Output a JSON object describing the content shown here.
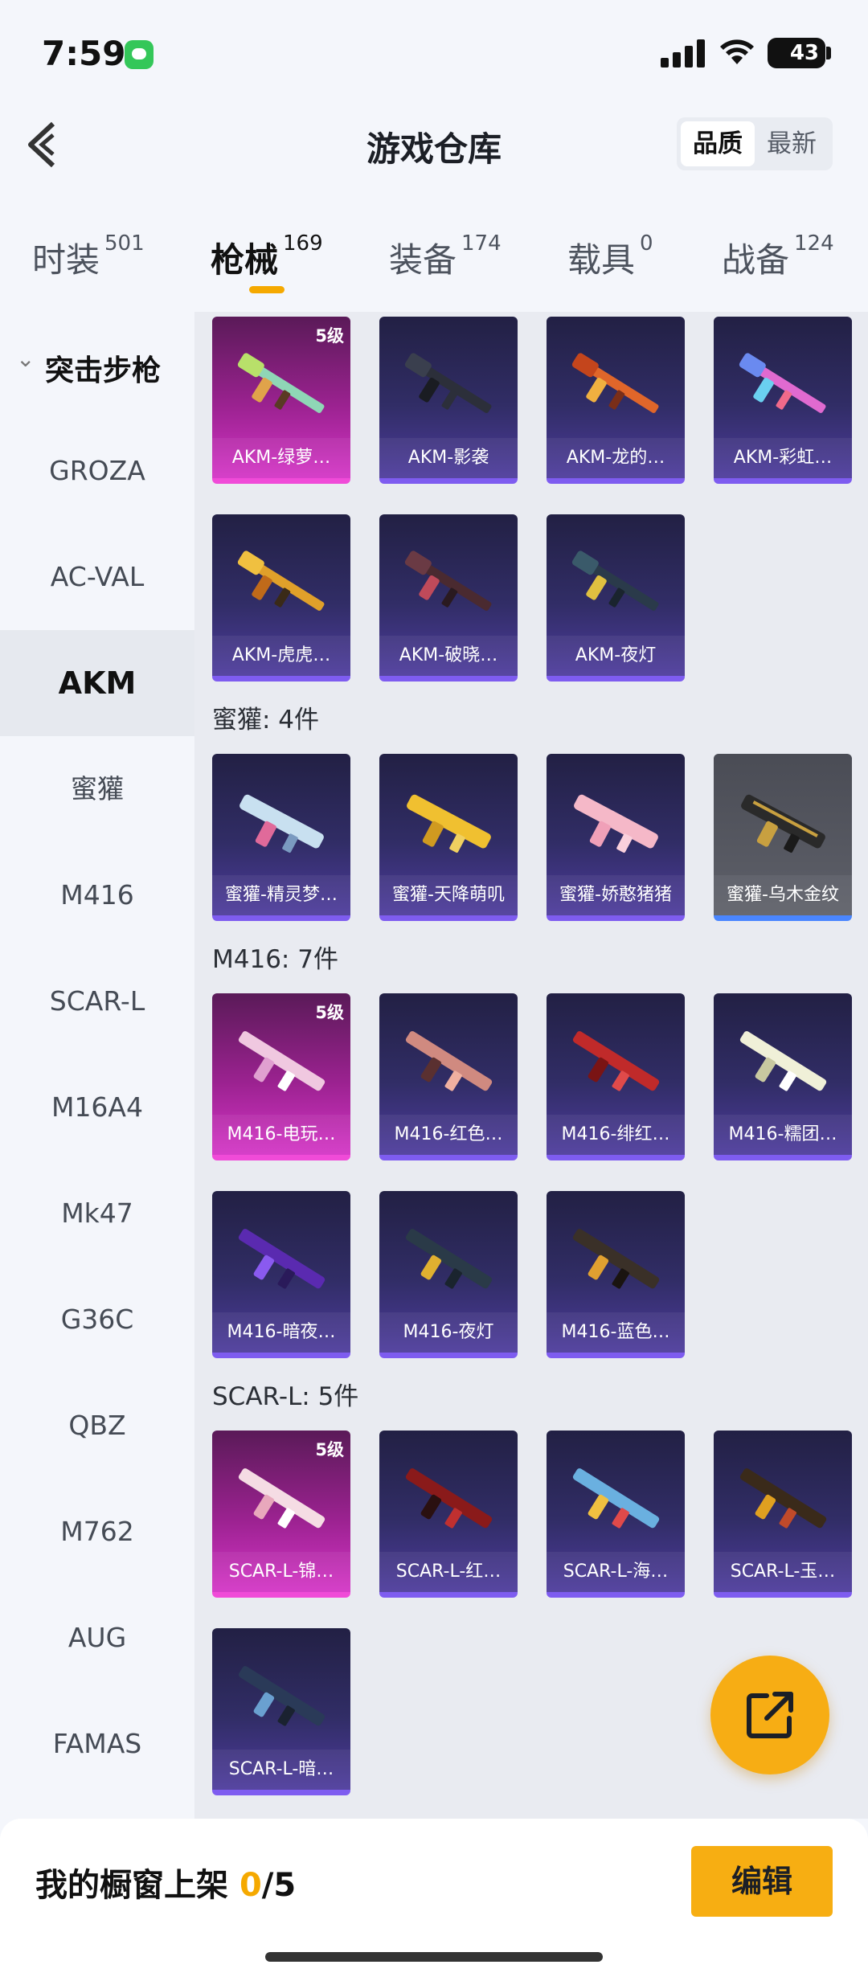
{
  "status": {
    "time": "7:59",
    "battery": "43"
  },
  "header": {
    "title": "游戏仓库",
    "sort": [
      "品质",
      "最新"
    ]
  },
  "tabs": [
    {
      "label": "时装",
      "count": "501"
    },
    {
      "label": "枪械",
      "count": "169"
    },
    {
      "label": "装备",
      "count": "174"
    },
    {
      "label": "载具",
      "count": "0"
    },
    {
      "label": "战备",
      "count": "124"
    }
  ],
  "sidebar": {
    "group": "突击步枪",
    "items": [
      "GROZA",
      "AC-VAL",
      "AKM",
      "蜜獾",
      "M416",
      "SCAR-L",
      "M16A4",
      "Mk47",
      "G36C",
      "QBZ",
      "M762",
      "AUG",
      "FAMAS"
    ]
  },
  "content": {
    "akm": [
      {
        "name": "AKM-绿萝…",
        "level": "5级"
      },
      {
        "name": "AKM-影袭"
      },
      {
        "name": "AKM-龙的…"
      },
      {
        "name": "AKM-彩虹…"
      },
      {
        "name": "AKM-虎虎…"
      },
      {
        "name": "AKM-破晓…"
      },
      {
        "name": "AKM-夜灯"
      }
    ],
    "honey_title": "蜜獾: 4件",
    "honey": [
      {
        "name": "蜜獾-精灵梦…"
      },
      {
        "name": "蜜獾-天降萌叽"
      },
      {
        "name": "蜜獾-娇憨猪猪"
      },
      {
        "name": "蜜獾-乌木金纹"
      }
    ],
    "m416_title": "M416: 7件",
    "m416": [
      {
        "name": "M416-电玩…",
        "level": "5级"
      },
      {
        "name": "M416-红色…"
      },
      {
        "name": "M416-绯红…"
      },
      {
        "name": "M416-糯团…"
      },
      {
        "name": "M416-暗夜…"
      },
      {
        "name": "M416-夜灯"
      },
      {
        "name": "M416-蓝色…"
      }
    ],
    "scar_title": "SCAR-L: 5件",
    "scar": [
      {
        "name": "SCAR-L-锦…",
        "level": "5级"
      },
      {
        "name": "SCAR-L-红…"
      },
      {
        "name": "SCAR-L-海…"
      },
      {
        "name": "SCAR-L-玉…"
      },
      {
        "name": "SCAR-L-暗…"
      }
    ]
  },
  "bottom": {
    "shelf_label": "我的橱窗上架",
    "shelf_current": "0",
    "shelf_total": "/5",
    "edit": "编辑"
  },
  "colors": {
    "accent": "#f5a900",
    "card_purple": "#312d66",
    "card_gold_pink": "#d434c6",
    "card_gray": "#5e6069"
  },
  "icons": [
    "back-arrow-icon",
    "chevron-down-icon",
    "share-export-icon",
    "gun-skin-icon"
  ]
}
